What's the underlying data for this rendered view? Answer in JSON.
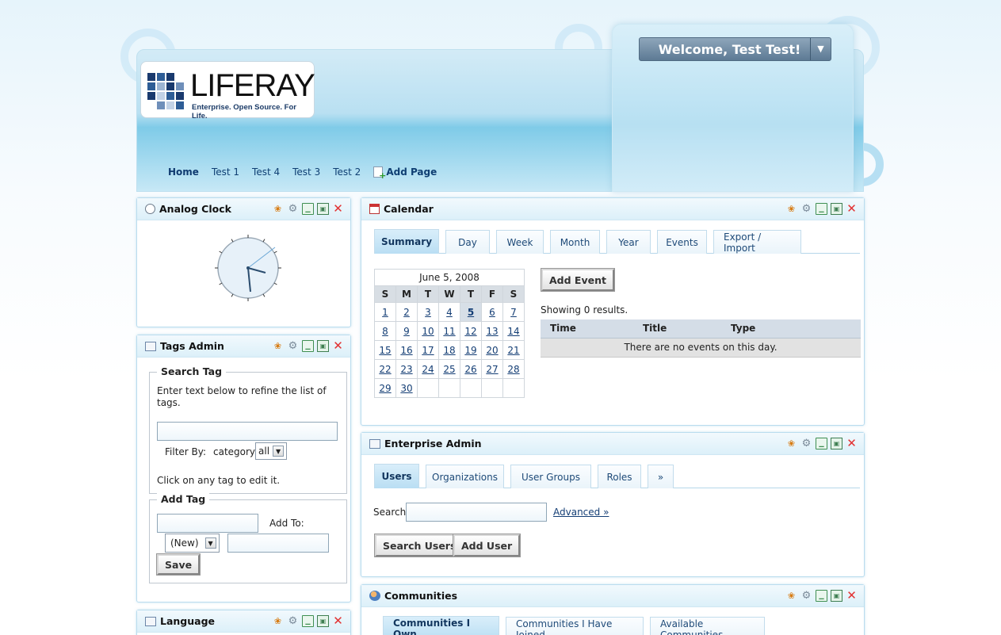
{
  "header": {
    "logo_word": "LIFERAY",
    "logo_tagline": "Enterprise. Open Source. For Life.",
    "welcome": "Welcome, Test Test!",
    "welcome_arrow": "▼",
    "nav": [
      "Home",
      "Test 1",
      "Test 4",
      "Test 3",
      "Test 2"
    ],
    "add_page": "Add Page"
  },
  "tool_icons": [
    "look-and-feel-icon",
    "configuration-icon",
    "minimize-icon",
    "maximize-icon",
    "close-icon"
  ],
  "analog_clock": {
    "title": "Analog Clock"
  },
  "tags_admin": {
    "title": "Tags Admin",
    "search_legend": "Search Tag",
    "instructions": "Enter text below to refine the list of tags.",
    "filter_label": "Filter By:",
    "filter_category": "category",
    "filter_value": "all",
    "click_hint": "Click on any tag to edit it.",
    "add_legend": "Add Tag",
    "add_to_label": "Add To:",
    "new_value": "(New)",
    "save": "Save"
  },
  "language": {
    "title": "Language"
  },
  "calendar": {
    "title": "Calendar",
    "tabs": [
      "Summary",
      "Day",
      "Week",
      "Month",
      "Year",
      "Events",
      "Export / Import"
    ],
    "month_header": "June 5, 2008",
    "dow": [
      "S",
      "M",
      "T",
      "W",
      "T",
      "F",
      "S"
    ],
    "weeks": [
      [
        "1",
        "2",
        "3",
        "4",
        "5",
        "6",
        "7"
      ],
      [
        "8",
        "9",
        "10",
        "11",
        "12",
        "13",
        "14"
      ],
      [
        "15",
        "16",
        "17",
        "18",
        "19",
        "20",
        "21"
      ],
      [
        "22",
        "23",
        "24",
        "25",
        "26",
        "27",
        "28"
      ],
      [
        "29",
        "30",
        "",
        "",
        "",
        "",
        ""
      ]
    ],
    "today": "5",
    "add_event": "Add Event",
    "showing": "Showing 0 results.",
    "columns": [
      "Time",
      "Title",
      "Type"
    ],
    "empty": "There are no events on this day."
  },
  "enterprise_admin": {
    "title": "Enterprise Admin",
    "tabs": [
      "Users",
      "Organizations",
      "User Groups",
      "Roles",
      "»"
    ],
    "search_label": "Search",
    "advanced": "Advanced »",
    "search_users": "Search Users",
    "add_user": "Add User"
  },
  "communities": {
    "title": "Communities",
    "tabs": [
      "Communities I Own",
      "Communities I Have Joined",
      "Available Communities"
    ]
  },
  "colors": {
    "accent": "#0f3f73",
    "header_blue": "#7fcbe8",
    "close_red": "#e23131"
  }
}
